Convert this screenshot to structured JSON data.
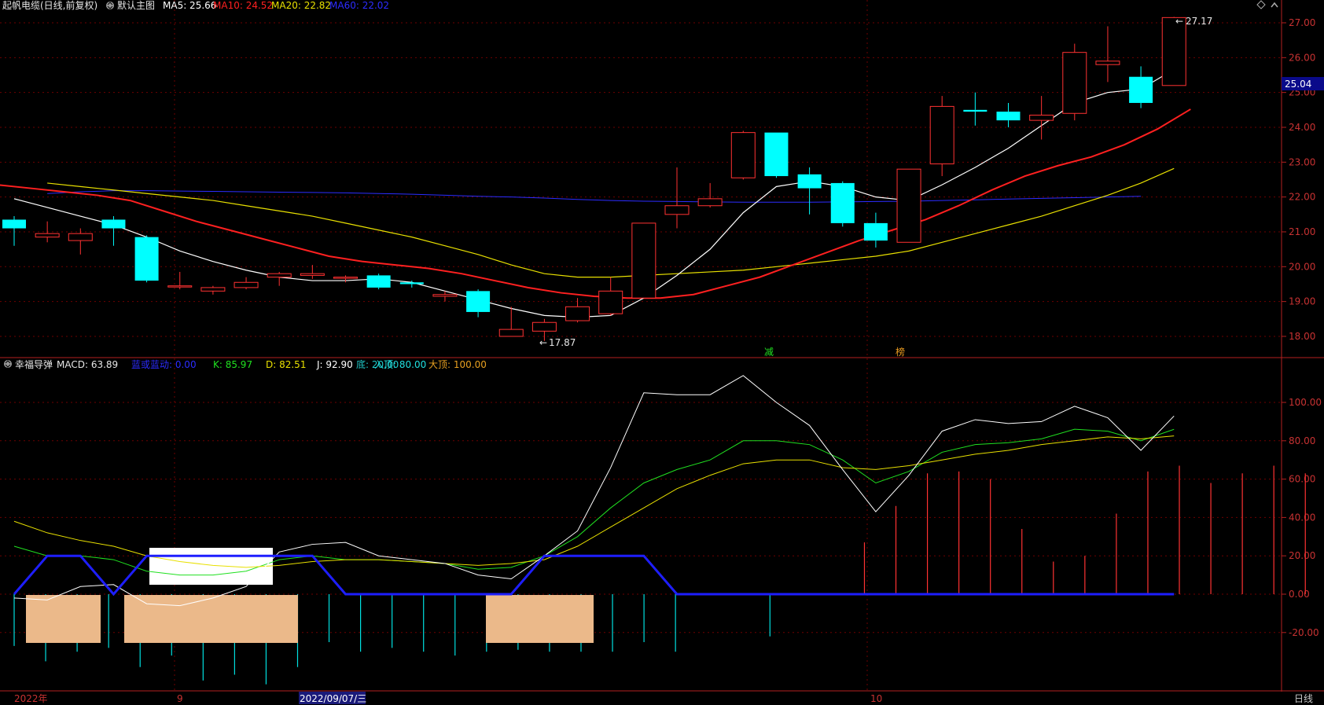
{
  "header": {
    "stock_title": "起帆电缆(日线,前复权)",
    "main_chart_label": "默认主图",
    "ma_values": [
      {
        "label": "MA5: 25.66",
        "color": "#ffffff"
      },
      {
        "label": "MA10: 24.52",
        "color": "#ff2020"
      },
      {
        "label": "MA20: 22.82",
        "color": "#e8e000"
      },
      {
        "label": "MA60: 22.02",
        "color": "#2c2cff"
      }
    ]
  },
  "price_panel": {
    "axis_ticks": [
      "27.00",
      "26.00",
      "25.00",
      "24.00",
      "23.00",
      "22.00",
      "21.00",
      "20.00",
      "19.00",
      "18.00"
    ],
    "current_price": "25.04",
    "high_label": "27.17",
    "low_label": "17.87",
    "markers": [
      "减",
      "榜"
    ],
    "candles": [
      {
        "o": 21.35,
        "h": 21.45,
        "l": 20.6,
        "c": 21.1
      },
      {
        "o": 20.85,
        "h": 21.3,
        "l": 20.7,
        "c": 20.95
      },
      {
        "o": 20.75,
        "h": 21.1,
        "l": 20.35,
        "c": 20.95
      },
      {
        "o": 21.35,
        "h": 21.45,
        "l": 20.6,
        "c": 21.1
      },
      {
        "o": 20.85,
        "h": 20.9,
        "l": 19.55,
        "c": 19.6
      },
      {
        "o": 19.45,
        "h": 19.85,
        "l": 19.35,
        "c": 19.45
      },
      {
        "o": 19.3,
        "h": 19.45,
        "l": 19.2,
        "c": 19.4
      },
      {
        "o": 19.4,
        "h": 19.7,
        "l": 19.35,
        "c": 19.55
      },
      {
        "o": 19.7,
        "h": 19.85,
        "l": 19.45,
        "c": 19.8
      },
      {
        "o": 19.75,
        "h": 20.05,
        "l": 19.65,
        "c": 19.8
      },
      {
        "o": 19.7,
        "h": 19.75,
        "l": 19.55,
        "c": 19.7
      },
      {
        "o": 19.75,
        "h": 19.8,
        "l": 19.35,
        "c": 19.4
      },
      {
        "o": 19.55,
        "h": 19.6,
        "l": 19.4,
        "c": 19.5
      },
      {
        "o": 19.15,
        "h": 19.3,
        "l": 19.0,
        "c": 19.2
      },
      {
        "o": 19.3,
        "h": 19.35,
        "l": 18.55,
        "c": 18.7
      },
      {
        "o": 18.0,
        "h": 18.85,
        "l": 18.0,
        "c": 18.2
      },
      {
        "o": 18.15,
        "h": 18.5,
        "l": 17.87,
        "c": 18.4
      },
      {
        "o": 18.45,
        "h": 19.1,
        "l": 18.4,
        "c": 18.85
      },
      {
        "o": 18.65,
        "h": 19.7,
        "l": 18.6,
        "c": 19.3
      },
      {
        "o": 19.1,
        "h": 21.25,
        "l": 19.1,
        "c": 21.25
      },
      {
        "o": 21.5,
        "h": 22.85,
        "l": 21.1,
        "c": 21.75
      },
      {
        "o": 21.75,
        "h": 22.4,
        "l": 21.7,
        "c": 21.95
      },
      {
        "o": 22.55,
        "h": 23.9,
        "l": 22.5,
        "c": 23.85
      },
      {
        "o": 23.85,
        "h": 23.85,
        "l": 22.55,
        "c": 22.6
      },
      {
        "o": 22.65,
        "h": 22.85,
        "l": 21.5,
        "c": 22.25
      },
      {
        "o": 22.4,
        "h": 22.45,
        "l": 21.15,
        "c": 21.25
      },
      {
        "o": 21.25,
        "h": 21.55,
        "l": 20.55,
        "c": 20.75
      },
      {
        "o": 20.7,
        "h": 22.8,
        "l": 20.7,
        "c": 22.8
      },
      {
        "o": 22.95,
        "h": 24.9,
        "l": 22.6,
        "c": 24.6
      },
      {
        "o": 24.5,
        "h": 25.0,
        "l": 24.05,
        "c": 24.45
      },
      {
        "o": 24.45,
        "h": 24.7,
        "l": 24.0,
        "c": 24.2
      },
      {
        "o": 24.2,
        "h": 24.9,
        "l": 23.65,
        "c": 24.35
      },
      {
        "o": 24.4,
        "h": 26.4,
        "l": 24.2,
        "c": 26.15
      },
      {
        "o": 25.8,
        "h": 26.9,
        "l": 25.3,
        "c": 25.9
      },
      {
        "o": 25.45,
        "h": 25.75,
        "l": 24.55,
        "c": 24.7
      },
      {
        "o": 25.2,
        "h": 27.17,
        "l": 25.2,
        "c": 27.15
      }
    ],
    "ma5": [
      21.95,
      21.7,
      21.45,
      21.2,
      20.85,
      20.45,
      20.15,
      19.9,
      19.7,
      19.6,
      19.6,
      19.65,
      19.55,
      19.3,
      19.05,
      18.8,
      18.6,
      18.55,
      18.6,
      19.1,
      19.75,
      20.5,
      21.55,
      22.3,
      22.45,
      22.3,
      22.0,
      21.9,
      22.35,
      22.85,
      23.4,
      24.05,
      24.7,
      25.0,
      25.1,
      25.66
    ],
    "ma10": [
      22.35,
      22.25,
      22.15,
      22.05,
      21.9,
      21.6,
      21.3,
      21.05,
      20.8,
      20.55,
      20.3,
      20.15,
      20.05,
      19.95,
      19.8,
      19.6,
      19.4,
      19.25,
      19.15,
      19.1,
      19.1,
      19.2,
      19.45,
      19.7,
      20.05,
      20.4,
      20.75,
      21.05,
      21.35,
      21.75,
      22.2,
      22.6,
      22.9,
      23.15,
      23.5,
      23.95,
      24.52
    ],
    "ma20": [
      22.4,
      22.3,
      22.2,
      22.1,
      22.0,
      21.9,
      21.75,
      21.6,
      21.45,
      21.25,
      21.05,
      20.85,
      20.6,
      20.35,
      20.05,
      19.8,
      19.7,
      19.7,
      19.75,
      19.8,
      19.85,
      19.9,
      20.0,
      20.1,
      20.2,
      20.3,
      20.45,
      20.7,
      20.95,
      21.2,
      21.45,
      21.75,
      22.05,
      22.4,
      22.82
    ],
    "ma60": [
      22.1,
      22.15,
      22.18,
      22.18,
      22.17,
      22.16,
      22.15,
      22.14,
      22.13,
      22.12,
      22.1,
      22.08,
      22.05,
      22.02,
      22.0,
      21.97,
      21.93,
      21.9,
      21.88,
      21.87,
      21.86,
      21.85,
      21.85,
      21.85,
      21.86,
      21.87,
      21.88,
      21.9,
      21.92,
      21.94,
      21.96,
      21.98,
      22.0,
      22.02
    ]
  },
  "indicator_panel": {
    "name": "幸福导弹",
    "macd_label": "MACD: 63.89",
    "legend": [
      {
        "label": "蓝或蓝动: 0.00",
        "color": "#2c2cff"
      },
      {
        "label": "K: 85.97",
        "color": "#20e020"
      },
      {
        "label": "D: 82.51",
        "color": "#e8e000"
      },
      {
        "label": "J: 92.90",
        "color": "#ffffff"
      },
      {
        "label": "底: 20.00",
        "color": "#20c8c8"
      },
      {
        "label": "入顶: 80.00",
        "color": "#20e0e0"
      },
      {
        "label": "大顶: 100.00",
        "color": "#e8a020"
      }
    ],
    "axis_ticks": [
      "100.00",
      "80.00",
      "60.00",
      "40.00",
      "20.00",
      "0.00",
      "-20.00"
    ],
    "macd_bars": [
      -27,
      -35,
      -30,
      -28,
      -38,
      -32,
      -45,
      -42,
      -47,
      -38,
      -25,
      -30,
      -28,
      -30,
      -32,
      -30,
      -29,
      -30,
      -30,
      -30,
      -25,
      -30,
      0,
      0,
      -22,
      0,
      0,
      27,
      46,
      63,
      64,
      60,
      34,
      17,
      20,
      42,
      64,
      67,
      58,
      63,
      67,
      63,
      64
    ],
    "k": [
      25,
      20,
      20,
      18,
      12,
      10,
      10,
      12,
      18,
      20,
      18,
      18,
      17,
      16,
      13,
      14,
      20,
      30,
      45,
      58,
      65,
      70,
      80,
      80,
      78,
      70,
      58,
      64,
      74,
      78,
      79,
      81,
      86,
      85,
      80,
      85.97
    ],
    "d": [
      38,
      32,
      28,
      25,
      20,
      17,
      15,
      14,
      15,
      17,
      18,
      18,
      17,
      16,
      15,
      16,
      18,
      25,
      35,
      45,
      55,
      62,
      68,
      70,
      70,
      66,
      65,
      67,
      70,
      73,
      75,
      78,
      80,
      82,
      81,
      82.51
    ],
    "j": [
      -2,
      -3,
      4,
      5,
      -5,
      -6,
      -2,
      4,
      22,
      26,
      27,
      20,
      18,
      16,
      10,
      8,
      20,
      33,
      66,
      105,
      104,
      104,
      114,
      100,
      88,
      65,
      43,
      62,
      85,
      91,
      89,
      90,
      98,
      92,
      75,
      92.9
    ],
    "blue_line": [
      0,
      20,
      20,
      0,
      20,
      20,
      20,
      20,
      20,
      20,
      0,
      0,
      0,
      0,
      0,
      0,
      20,
      20,
      20,
      20,
      0,
      0,
      0,
      0,
      0,
      0,
      0,
      0,
      0,
      0,
      0,
      0,
      0,
      0,
      0,
      0,
      0,
      0,
      0,
      0
    ],
    "overlay_boxes": 3
  },
  "time_axis": {
    "labels": [
      "2022年",
      "9",
      "2022/09/07/三",
      "10"
    ],
    "period_label": "日线"
  },
  "colors": {
    "up": "#ff3232",
    "down": "#00ffff",
    "grid": "#8b0000",
    "axis_text": "#c83232"
  },
  "icons": [
    "diamond-icon",
    "chevron-up-down-icon",
    "collapse-icon"
  ]
}
